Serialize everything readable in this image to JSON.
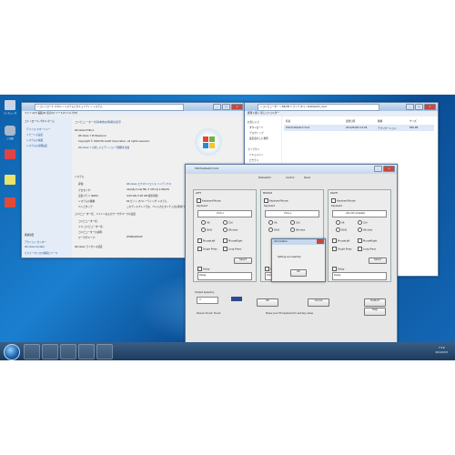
{
  "desktop": {
    "icons": [
      {
        "label": "コンピュータ",
        "color": "#c9d6e8"
      },
      {
        "label": "ごみ箱",
        "color": "#aab9cc"
      },
      {
        "label": "",
        "color": "#d44"
      },
      {
        "label": "",
        "color": "#e9e36c"
      },
      {
        "label": "",
        "color": "#e04a3a"
      }
    ]
  },
  "sysinfo": {
    "address": "« コントロール パネル » システムとセキュリティ » システム",
    "menu": "ファイル(F)  編集(E)  表示(V)  ツール(T)  ヘルプ(H)",
    "sidebar": [
      "コントロール パネル ホーム",
      "デバイス マネージャー",
      "リモートの設定",
      "システムの保護",
      "システムの詳細設定"
    ],
    "see_also": "関連項目",
    "see_also_items": [
      "アクション センター",
      "Windows Update",
      "パフォーマンスの情報とツール"
    ],
    "heading": "コンピューターの基本的な情報の表示",
    "edition_label": "Windows Edition",
    "edition": "Windows 7 Professional",
    "copyright": "Copyright © 2009 Microsoft Corporation. All rights reserved.",
    "service_pack": "Windows 7 の新しいエディションで機能を追加",
    "system_label": "システム",
    "rows": [
      {
        "k": "評価:",
        "v": "Windows エクスペリエンス インデックス"
      },
      {
        "k": "プロセッサ:",
        "v": "Intel(R) Core(TM) i7 CPU  @ 2.80GHz"
      },
      {
        "k": "実装メモリ (RAM):",
        "v": "4.00 GB (3.00 GB 使用可能)"
      },
      {
        "k": "システムの種類:",
        "v": "64 ビット オペレーティング システム"
      },
      {
        "k": "ペンとタッチ:",
        "v": "このディスプレイでは、ペン入力とタッチ入力は利用できません"
      }
    ],
    "computer_section": "コンピューター名、ドメインおよびワークグループの設定",
    "comp_rows": [
      {
        "k": "コンピューター名:",
        "v": ""
      },
      {
        "k": "フル コンピューター名:",
        "v": ""
      },
      {
        "k": "コンピューターの説明:",
        "v": ""
      },
      {
        "k": "ワークグループ:",
        "v": "WORKGROUP"
      }
    ],
    "activation": "Windows ライセンス認証"
  },
  "explorer": {
    "address": "« コンピューター » RB-HB ドライブ (E:) » PostSwitch_V4.0",
    "toolbar": "整理 ▾   開く   新しいフォルダー",
    "col_name": "名前",
    "col_date": "更新日時",
    "col_type": "種類",
    "col_size": "サイズ",
    "file_name": "HID PostSwitch V4.0",
    "file_date": "2012/03/03 13:29",
    "file_type": "アプリケーション",
    "file_size": "836 KB",
    "nav": [
      "お気に入り",
      "ダウンロード",
      "デスクトップ",
      "最近表示した場所",
      "",
      "ライブラリ",
      "ドキュメント",
      "ピクチャ",
      "ビデオ",
      "ミュージック"
    ]
  },
  "postswitch": {
    "title": "HID PostSwitch V4.0",
    "tabs": [
      "Postswitch",
      "Control",
      "Panel"
    ],
    "groups": [
      {
        "name": "LEFT",
        "mode": "KeyboardMouse",
        "key_label": "Keyboard",
        "combo": "Ctrl+c",
        "opt1": "Alt",
        "opt2": "Ctrl",
        "opt3": "Shift",
        "opt4": "Window"
      },
      {
        "name": "MIDDLE",
        "mode": "KeyboardMouse",
        "key_label": "Keyboard",
        "combo": "Ctrl+v",
        "opt1": "Alt",
        "opt2": "Ctrl",
        "opt3": "Shift",
        "opt4": "Window"
      },
      {
        "name": "RIGHT",
        "mode": "KeyboardMouse",
        "key_label": "Keyboard",
        "combo": "Alt+Ctrl+Delete",
        "opt1": "Alt",
        "opt2": "Ctrl",
        "opt3": "Shift",
        "opt4": "Window"
      }
    ],
    "mouse_left": "MouseLeft",
    "mouse_right": "MouseRight",
    "single_press": "Single Press",
    "long_press": "Long Press",
    "select": "Select",
    "delay_label": "Delay",
    "delay_ms": "Delay",
    "repeat_label": "Output  speed/cy",
    "repeat_value": "3",
    "ok": "OK",
    "cancel": "Cancel",
    "default": "Default",
    "help": "Help",
    "status_left": "Device found: found.",
    "status_mid": "Press your PC keyboard to set key value",
    "dialog_title": "Information",
    "dialog_text": "Setting successfully",
    "dialog_ok": "OK"
  },
  "taskbar": {
    "time": "7:16",
    "date": "2012/3/3"
  }
}
